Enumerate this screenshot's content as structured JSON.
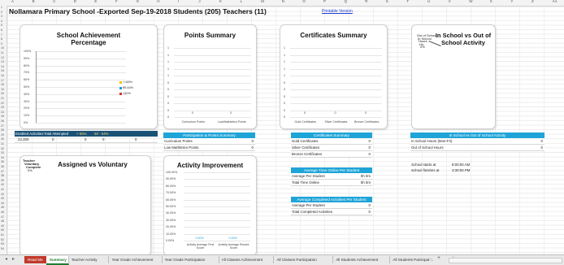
{
  "sheet": {
    "title": "Nollamara Primary School -Exported Sep-19-2018   Students (205)  Teachers (11)",
    "printable_link": "Printable Version",
    "columns": [
      "A",
      "B",
      "C",
      "D",
      "E",
      "F",
      "G",
      "H",
      "I",
      "J",
      "K",
      "L",
      "M",
      "N",
      "O",
      "P",
      "Q",
      "R",
      "S",
      "T",
      "U",
      "V",
      "W",
      "X",
      "Y",
      "Z",
      "AA"
    ],
    "rows": [
      "1",
      "2",
      "3",
      "4",
      "5",
      "6",
      "7",
      "8",
      "9",
      "10",
      "11",
      "12",
      "13",
      "14",
      "15",
      "16",
      "17",
      "18",
      "19",
      "20",
      "21",
      "22",
      "23",
      "24",
      "25",
      "26",
      "27",
      "28",
      "29",
      "30",
      "31",
      "32",
      "33",
      "34",
      "35",
      "36",
      "37",
      "38",
      "39",
      "40",
      "41",
      "42",
      "43",
      "44",
      "45",
      "46",
      "47",
      "48",
      "49",
      "50",
      "51",
      "52",
      "53",
      "54"
    ]
  },
  "achievement_chart": {
    "title": "School Achievement Percentage",
    "yticks": [
      "100%",
      "90%",
      "80%",
      "70%",
      "60%",
      "50%",
      "40%",
      "30%",
      "20%",
      "10%",
      "0%"
    ],
    "legend": [
      {
        "label": ">=65%",
        "color": "#f2c200"
      },
      {
        "label": "50-64%",
        "color": "#1f9bd7"
      },
      {
        "label": "<50%",
        "color": "#d9342b"
      }
    ]
  },
  "points_chart": {
    "title": "Points Summary",
    "yticks": [
      "1",
      "1",
      "1",
      "1",
      "1",
      "0",
      "0",
      "0",
      "0",
      "0",
      "0"
    ],
    "categories": [
      "Curriculum Points",
      "Low/Mathletics Points"
    ],
    "values": [
      0,
      0
    ],
    "value_labels": [
      "0",
      "0"
    ]
  },
  "certificates_chart": {
    "title": "Certificates Summary",
    "yticks": [
      "1",
      "1",
      "1",
      "1",
      "1",
      "0",
      "0",
      "0",
      "0",
      "0",
      "0"
    ],
    "categories": [
      "Gold Certificates",
      "Silver Certificates",
      "Bronze Certificates"
    ],
    "values": [
      0,
      0,
      0
    ],
    "value_labels": [
      "0",
      "0",
      "0"
    ]
  },
  "inschool_chart": {
    "title": "In School vs Out of School Activity",
    "overlap_labels": [
      "Out of School",
      "In School",
      "Hours",
      "Ho..",
      "0%"
    ]
  },
  "assigned_chart": {
    "title": "Assigned vs Voluntary",
    "overlap_labels": [
      "Teacher",
      "Voluntary",
      "Complete",
      "0%"
    ]
  },
  "improvement_chart": {
    "title": "Activity Improvement",
    "yticks": [
      "100.00%",
      "90.00%",
      "80.00%",
      "70.00%",
      "60.00%",
      "50.00%",
      "40.00%",
      "30.00%",
      "20.00%",
      "10.00%",
      "0.00%"
    ],
    "categories": [
      "Activity Average First Score",
      "Activity Average Recent Score"
    ],
    "values": [
      0,
      0
    ],
    "value_labels": [
      "0.00%",
      "0.00%"
    ]
  },
  "enabled_row": {
    "headers": [
      "Enabled Activities",
      "Total Attempted",
      "> 65%",
      "50 - 64%",
      ""
    ],
    "values": [
      "22,200",
      "0",
      "0",
      "0",
      "0"
    ]
  },
  "participation_table": {
    "header": "Participation & Points Summary",
    "rows": [
      {
        "label": "Curriculum Points",
        "value": "0"
      },
      {
        "label": "Low Mathletics Points",
        "value": "0"
      }
    ]
  },
  "certificates_table": {
    "header": "Certificates Summary",
    "rows": [
      {
        "label": "Gold Certificates",
        "value": "0"
      },
      {
        "label": "Silver Certificates",
        "value": "0"
      },
      {
        "label": "Bronze Certificates",
        "value": "0"
      }
    ]
  },
  "inschool_table": {
    "header": "In School vs Out of School Activity",
    "rows": [
      {
        "label": "In School Hours (Mon-Fri)",
        "value": "0"
      },
      {
        "label": "Out of School Hours",
        "value": "0"
      }
    ]
  },
  "times": {
    "start_label": "School starts at",
    "start_value": "8:00:00 AM",
    "finish_label": "School finishes at",
    "finish_value": "3:30:00 PM"
  },
  "avg_time_table": {
    "header": "Average Time Online Per Student",
    "rows": [
      {
        "label": "Average Per Student",
        "value": "0h 0m"
      },
      {
        "label": "Total Time Online",
        "value": "0h 0m"
      }
    ]
  },
  "avg_completed_table": {
    "header": "Average Completed Activities Per Student",
    "rows": [
      {
        "label": "Average Per Student",
        "value": "0"
      },
      {
        "label": "Total Completed Activities",
        "value": "0"
      }
    ]
  },
  "tabs": [
    {
      "label": "Read Me",
      "active": false,
      "color": "#c0392b"
    },
    {
      "label": "Summary",
      "active": true
    },
    {
      "label": "Teacher Activity"
    },
    {
      "label": "Year Grade Achievement"
    },
    {
      "label": "Year Grade Participation"
    },
    {
      "label": "All Classes Achievement"
    },
    {
      "label": "All Classes Participation"
    },
    {
      "label": "All Students Achievement"
    },
    {
      "label": "All Students Participat ..."
    }
  ],
  "tab_nav": {
    "prev": "◂",
    "next": "▸",
    "more": "...",
    "add": "+"
  }
}
